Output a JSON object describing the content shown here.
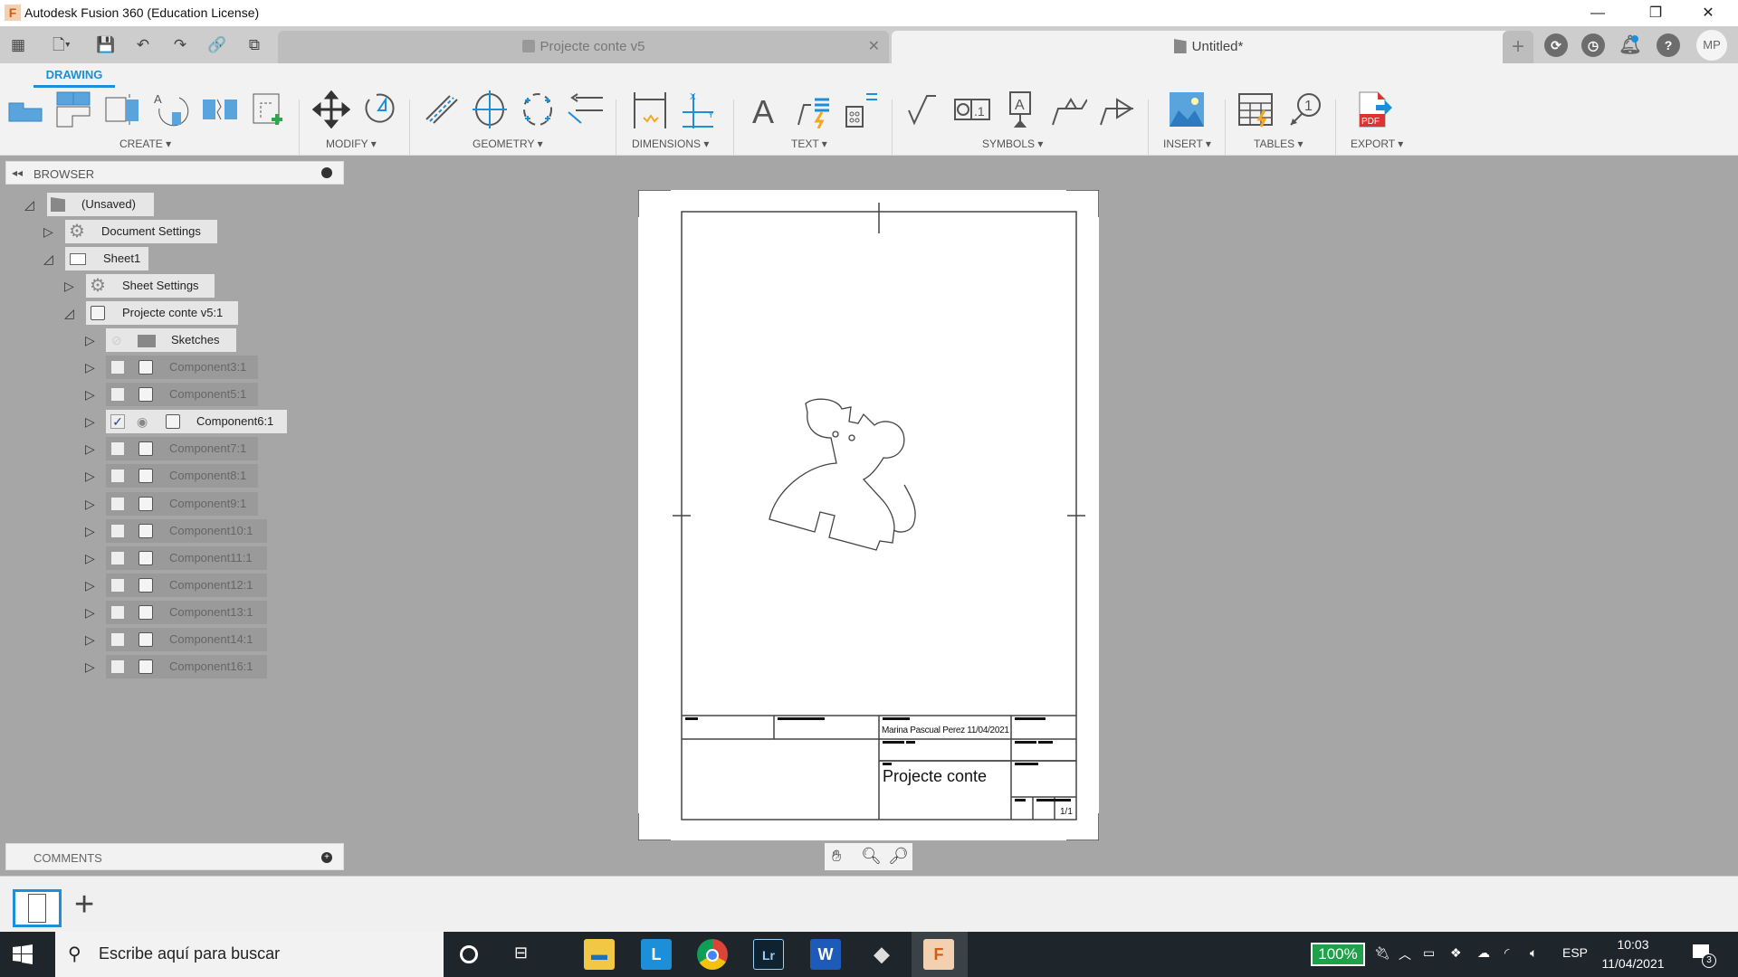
{
  "window": {
    "app_title": "Autodesk Fusion 360 (Education License)",
    "minimize": "—",
    "maximize": "❐",
    "close": "✕"
  },
  "quick_access": [
    {
      "name": "data-panel-icon",
      "glyph": "▦"
    },
    {
      "name": "file-menu-icon",
      "glyph": "🗋▾"
    },
    {
      "name": "save-icon",
      "glyph": "💾"
    },
    {
      "name": "undo-icon",
      "glyph": "↶"
    },
    {
      "name": "redo-icon",
      "glyph": "↷"
    },
    {
      "name": "link-icon",
      "glyph": "🔗"
    },
    {
      "name": "copy-icon",
      "glyph": "⧉"
    }
  ],
  "tabs": [
    {
      "label": "Projecte conte v5",
      "active": false,
      "close": "✕"
    },
    {
      "label": "Untitled*",
      "active": true,
      "close": "✕"
    }
  ],
  "header_right": {
    "new_tab": "+",
    "user_initials": "MP"
  },
  "ribbon": {
    "workspace_tab": "DRAWING",
    "groups": [
      {
        "label": "CREATE ▾"
      },
      {
        "label": "MODIFY ▾"
      },
      {
        "label": "GEOMETRY ▾"
      },
      {
        "label": "DIMENSIONS ▾"
      },
      {
        "label": "TEXT ▾"
      },
      {
        "label": "SYMBOLS ▾"
      },
      {
        "label": "INSERT ▾"
      },
      {
        "label": "TABLES ▾"
      },
      {
        "label": "EXPORT ▾"
      }
    ],
    "accent": "#1d8fd8"
  },
  "browser": {
    "title": "BROWSER",
    "nodes": [
      {
        "label": "(Unsaved)"
      },
      {
        "label": "Document Settings"
      },
      {
        "label": "Sheet1"
      },
      {
        "label": "Sheet Settings"
      },
      {
        "label": "Projecte conte v5:1"
      },
      {
        "label": "Sketches"
      }
    ],
    "components": [
      {
        "label": "Component3:1",
        "visible": false
      },
      {
        "label": "Component5:1",
        "visible": false
      },
      {
        "label": "Component6:1",
        "visible": true
      },
      {
        "label": "Component7:1",
        "visible": false
      },
      {
        "label": "Component8:1",
        "visible": false
      },
      {
        "label": "Component9:1",
        "visible": false
      },
      {
        "label": "Component10:1",
        "visible": false
      },
      {
        "label": "Component11:1",
        "visible": false
      },
      {
        "label": "Component12:1",
        "visible": false
      },
      {
        "label": "Component13:1",
        "visible": false
      },
      {
        "label": "Component14:1",
        "visible": false
      },
      {
        "label": "Component16:1",
        "visible": false
      }
    ]
  },
  "sheet": {
    "title_block": {
      "author_date": "Marina Pascual Perez  11/04/2021",
      "title": "Projecte conte",
      "sheet_number": "1/1"
    }
  },
  "comments": {
    "title": "COMMENTS"
  },
  "bottom_bar": {
    "add_sheet": "+"
  },
  "taskbar": {
    "search_placeholder": "Escribe aquí para buscar",
    "battery": "100%",
    "language": "ESP",
    "time": "10:03",
    "date": "11/04/2021",
    "notifications": "3"
  }
}
